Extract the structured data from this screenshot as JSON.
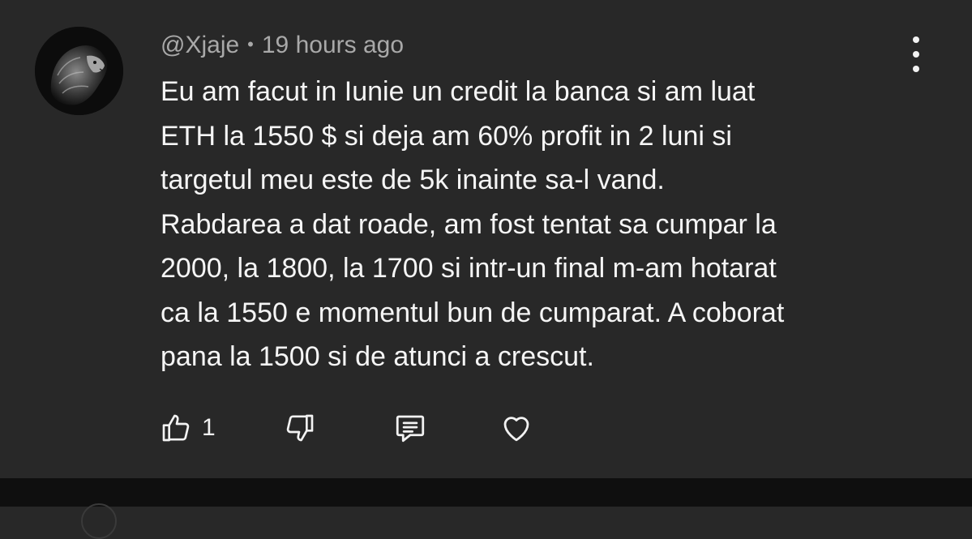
{
  "comment": {
    "author": "@Xjaje",
    "separator": "•",
    "timestamp": "19 hours ago",
    "text": "Eu am facut in Iunie un credit la banca si am luat\nETH la 1550 $ si deja am 60% profit in 2 luni si\ntargetul meu este de 5k inainte sa-l vand.\nRabdarea a dat roade, am fost tentat sa cumpar la\n2000, la 1800, la 1700 si intr-un final m-am hotarat\nca la 1550 e momentul bun de cumparat. A coborat\npana la 1500 si de atunci a crescut.",
    "like_count": "1"
  },
  "icons": {
    "avatar": "lion-avatar",
    "more": "more-vertical-icon",
    "like": "thumbs-up-icon",
    "dislike": "thumbs-down-icon",
    "reply": "comment-reply-icon",
    "heart": "heart-icon"
  },
  "colors": {
    "background": "#282828",
    "bottom_bar": "#0f0f0f",
    "meta_text": "#a9a9a9",
    "body_text": "#f5f5f5"
  }
}
